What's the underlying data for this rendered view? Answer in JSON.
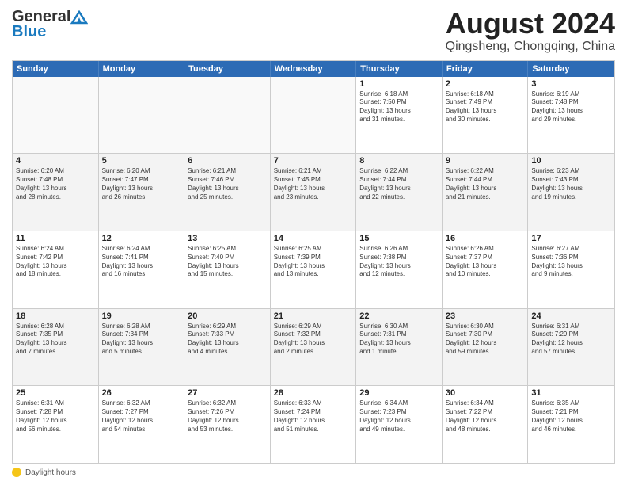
{
  "logo": {
    "general": "General",
    "blue": "Blue"
  },
  "title": "August 2024",
  "subtitle": "Qingsheng, Chongqing, China",
  "days": [
    "Sunday",
    "Monday",
    "Tuesday",
    "Wednesday",
    "Thursday",
    "Friday",
    "Saturday"
  ],
  "footer_label": "Daylight hours",
  "weeks": [
    [
      {
        "day": "",
        "info": ""
      },
      {
        "day": "",
        "info": ""
      },
      {
        "day": "",
        "info": ""
      },
      {
        "day": "",
        "info": ""
      },
      {
        "day": "1",
        "info": "Sunrise: 6:18 AM\nSunset: 7:50 PM\nDaylight: 13 hours\nand 31 minutes."
      },
      {
        "day": "2",
        "info": "Sunrise: 6:18 AM\nSunset: 7:49 PM\nDaylight: 13 hours\nand 30 minutes."
      },
      {
        "day": "3",
        "info": "Sunrise: 6:19 AM\nSunset: 7:48 PM\nDaylight: 13 hours\nand 29 minutes."
      }
    ],
    [
      {
        "day": "4",
        "info": "Sunrise: 6:20 AM\nSunset: 7:48 PM\nDaylight: 13 hours\nand 28 minutes."
      },
      {
        "day": "5",
        "info": "Sunrise: 6:20 AM\nSunset: 7:47 PM\nDaylight: 13 hours\nand 26 minutes."
      },
      {
        "day": "6",
        "info": "Sunrise: 6:21 AM\nSunset: 7:46 PM\nDaylight: 13 hours\nand 25 minutes."
      },
      {
        "day": "7",
        "info": "Sunrise: 6:21 AM\nSunset: 7:45 PM\nDaylight: 13 hours\nand 23 minutes."
      },
      {
        "day": "8",
        "info": "Sunrise: 6:22 AM\nSunset: 7:44 PM\nDaylight: 13 hours\nand 22 minutes."
      },
      {
        "day": "9",
        "info": "Sunrise: 6:22 AM\nSunset: 7:44 PM\nDaylight: 13 hours\nand 21 minutes."
      },
      {
        "day": "10",
        "info": "Sunrise: 6:23 AM\nSunset: 7:43 PM\nDaylight: 13 hours\nand 19 minutes."
      }
    ],
    [
      {
        "day": "11",
        "info": "Sunrise: 6:24 AM\nSunset: 7:42 PM\nDaylight: 13 hours\nand 18 minutes."
      },
      {
        "day": "12",
        "info": "Sunrise: 6:24 AM\nSunset: 7:41 PM\nDaylight: 13 hours\nand 16 minutes."
      },
      {
        "day": "13",
        "info": "Sunrise: 6:25 AM\nSunset: 7:40 PM\nDaylight: 13 hours\nand 15 minutes."
      },
      {
        "day": "14",
        "info": "Sunrise: 6:25 AM\nSunset: 7:39 PM\nDaylight: 13 hours\nand 13 minutes."
      },
      {
        "day": "15",
        "info": "Sunrise: 6:26 AM\nSunset: 7:38 PM\nDaylight: 13 hours\nand 12 minutes."
      },
      {
        "day": "16",
        "info": "Sunrise: 6:26 AM\nSunset: 7:37 PM\nDaylight: 13 hours\nand 10 minutes."
      },
      {
        "day": "17",
        "info": "Sunrise: 6:27 AM\nSunset: 7:36 PM\nDaylight: 13 hours\nand 9 minutes."
      }
    ],
    [
      {
        "day": "18",
        "info": "Sunrise: 6:28 AM\nSunset: 7:35 PM\nDaylight: 13 hours\nand 7 minutes."
      },
      {
        "day": "19",
        "info": "Sunrise: 6:28 AM\nSunset: 7:34 PM\nDaylight: 13 hours\nand 5 minutes."
      },
      {
        "day": "20",
        "info": "Sunrise: 6:29 AM\nSunset: 7:33 PM\nDaylight: 13 hours\nand 4 minutes."
      },
      {
        "day": "21",
        "info": "Sunrise: 6:29 AM\nSunset: 7:32 PM\nDaylight: 13 hours\nand 2 minutes."
      },
      {
        "day": "22",
        "info": "Sunrise: 6:30 AM\nSunset: 7:31 PM\nDaylight: 13 hours\nand 1 minute."
      },
      {
        "day": "23",
        "info": "Sunrise: 6:30 AM\nSunset: 7:30 PM\nDaylight: 12 hours\nand 59 minutes."
      },
      {
        "day": "24",
        "info": "Sunrise: 6:31 AM\nSunset: 7:29 PM\nDaylight: 12 hours\nand 57 minutes."
      }
    ],
    [
      {
        "day": "25",
        "info": "Sunrise: 6:31 AM\nSunset: 7:28 PM\nDaylight: 12 hours\nand 56 minutes."
      },
      {
        "day": "26",
        "info": "Sunrise: 6:32 AM\nSunset: 7:27 PM\nDaylight: 12 hours\nand 54 minutes."
      },
      {
        "day": "27",
        "info": "Sunrise: 6:32 AM\nSunset: 7:26 PM\nDaylight: 12 hours\nand 53 minutes."
      },
      {
        "day": "28",
        "info": "Sunrise: 6:33 AM\nSunset: 7:24 PM\nDaylight: 12 hours\nand 51 minutes."
      },
      {
        "day": "29",
        "info": "Sunrise: 6:34 AM\nSunset: 7:23 PM\nDaylight: 12 hours\nand 49 minutes."
      },
      {
        "day": "30",
        "info": "Sunrise: 6:34 AM\nSunset: 7:22 PM\nDaylight: 12 hours\nand 48 minutes."
      },
      {
        "day": "31",
        "info": "Sunrise: 6:35 AM\nSunset: 7:21 PM\nDaylight: 12 hours\nand 46 minutes."
      }
    ]
  ]
}
